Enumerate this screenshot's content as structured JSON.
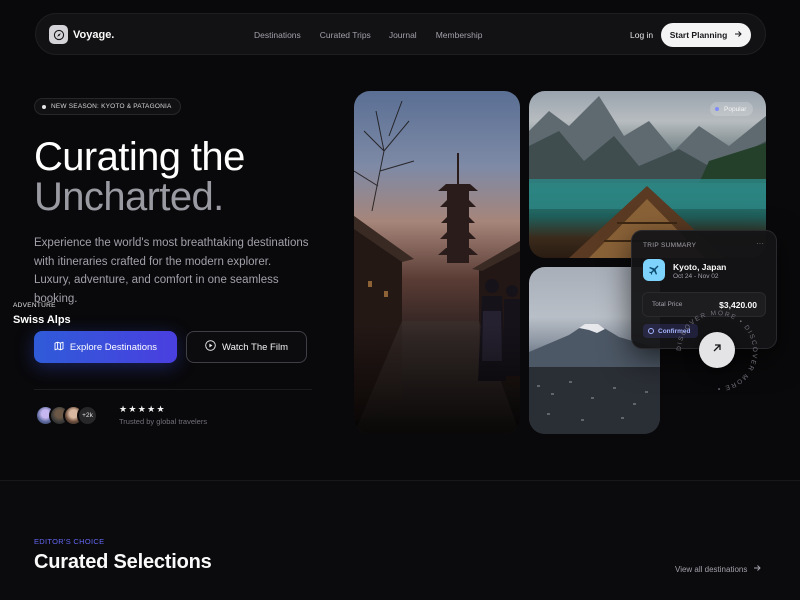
{
  "nav": {
    "brand": "Voyage.",
    "links": [
      "Destinations",
      "Curated Trips",
      "Journal",
      "Membership"
    ],
    "login": "Log in",
    "cta": "Start Planning"
  },
  "hero": {
    "badge": "NEW SEASON: KYOTO & PATAGONIA",
    "title_line1": "Curating the",
    "title_line2": "Uncharted",
    "title_line2_dot": ".",
    "subtitle": "Experience the world's most breathtaking destinations with itineraries crafted for the modern explorer. Luxury, adventure, and comfort in one seamless booking.",
    "primary_cta": "Explore Destinations",
    "secondary_cta": "Watch The Film",
    "social": {
      "more_count": "+2k",
      "stars": "★★★★★",
      "rating": 5,
      "caption": "Trusted by global travelers"
    }
  },
  "gallery": {
    "feature_tag": "ADVENTURE",
    "feature_title": "Swiss Alps",
    "popular_badge": "Popular"
  },
  "trip_summary": {
    "heading": "TRIP SUMMARY",
    "more": "···",
    "city": "Kyoto, Japan",
    "dates": "Oct 24 - Nov 02",
    "price_label": "Total Price",
    "price": "$3,420.00",
    "status": "Confirmed"
  },
  "discover": {
    "ring_text": "DISCOVER MORE • DISCOVER MORE • "
  },
  "section": {
    "eyebrow": "EDITOR'S CHOICE",
    "title": "Curated Selections",
    "view_all": "View all destinations"
  },
  "colors": {
    "background": "#09090b",
    "accent_blue": "#2f5bd8",
    "accent_indigo": "#6366f1",
    "plane_tile": "#7dd3fc"
  }
}
